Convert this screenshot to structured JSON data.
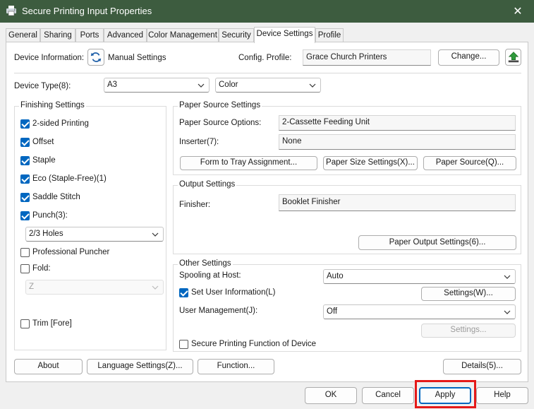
{
  "window": {
    "title": "Secure Printing Input Properties",
    "close_glyph": "✕"
  },
  "tabs": [
    {
      "label": "General"
    },
    {
      "label": "Sharing"
    },
    {
      "label": "Ports"
    },
    {
      "label": "Advanced"
    },
    {
      "label": "Color Management"
    },
    {
      "label": "Security"
    },
    {
      "label": "Device Settings"
    },
    {
      "label": "Profile"
    }
  ],
  "device_info": {
    "label": "Device Information:",
    "value": "Manual Settings",
    "config_label": "Config. Profile:",
    "config_value": "Grace Church Printers",
    "change_button": "Change..."
  },
  "device_type": {
    "label": "Device Type(8):",
    "size": "A3",
    "color": "Color"
  },
  "finishing": {
    "title": "Finishing Settings",
    "items": [
      {
        "label": "2-sided Printing",
        "checked": true
      },
      {
        "label": "Offset",
        "checked": true
      },
      {
        "label": "Staple",
        "checked": true
      },
      {
        "label": "Eco (Staple-Free)(1)",
        "checked": true
      },
      {
        "label": "Saddle Stitch",
        "checked": true
      },
      {
        "label": "Punch(3):",
        "checked": true
      }
    ],
    "punch_value": "2/3 Holes",
    "professional_puncher": {
      "label": "Professional Puncher",
      "checked": false
    },
    "fold": {
      "label": "Fold:",
      "checked": false,
      "value": "Z"
    },
    "trim": {
      "label": "Trim [Fore]",
      "checked": false
    }
  },
  "paper_source": {
    "title": "Paper Source Settings",
    "options_label": "Paper Source Options:",
    "options_value": "2-Cassette Feeding Unit",
    "inserter_label": "Inserter(7):",
    "inserter_value": "None",
    "btn_tray": "Form to Tray Assignment...",
    "btn_size": "Paper Size Settings(X)...",
    "btn_source": "Paper Source(Q)..."
  },
  "output": {
    "title": "Output Settings",
    "finisher_label": "Finisher:",
    "finisher_value": "Booklet Finisher",
    "btn_output": "Paper Output Settings(6)..."
  },
  "other": {
    "title": "Other Settings",
    "spooling_label": "Spooling at Host:",
    "spooling_value": "Auto",
    "user_info_label": "Set User Information(L)",
    "user_info_checked": true,
    "settings_w": "Settings(W)...",
    "user_mgmt_label": "User Management(J):",
    "user_mgmt_value": "Off",
    "settings_disabled": "Settings...",
    "secure_label": "Secure Printing Function of Device",
    "secure_checked": false
  },
  "bottom_buttons": {
    "about": "About",
    "language": "Language Settings(Z)...",
    "function": "Function...",
    "details": "Details(5)..."
  },
  "dialog_buttons": {
    "ok": "OK",
    "cancel": "Cancel",
    "apply": "Apply",
    "help": "Help"
  },
  "colors": {
    "titlebar": "#3d5c3f",
    "accent": "#0067c0",
    "highlight": "#e51919"
  }
}
